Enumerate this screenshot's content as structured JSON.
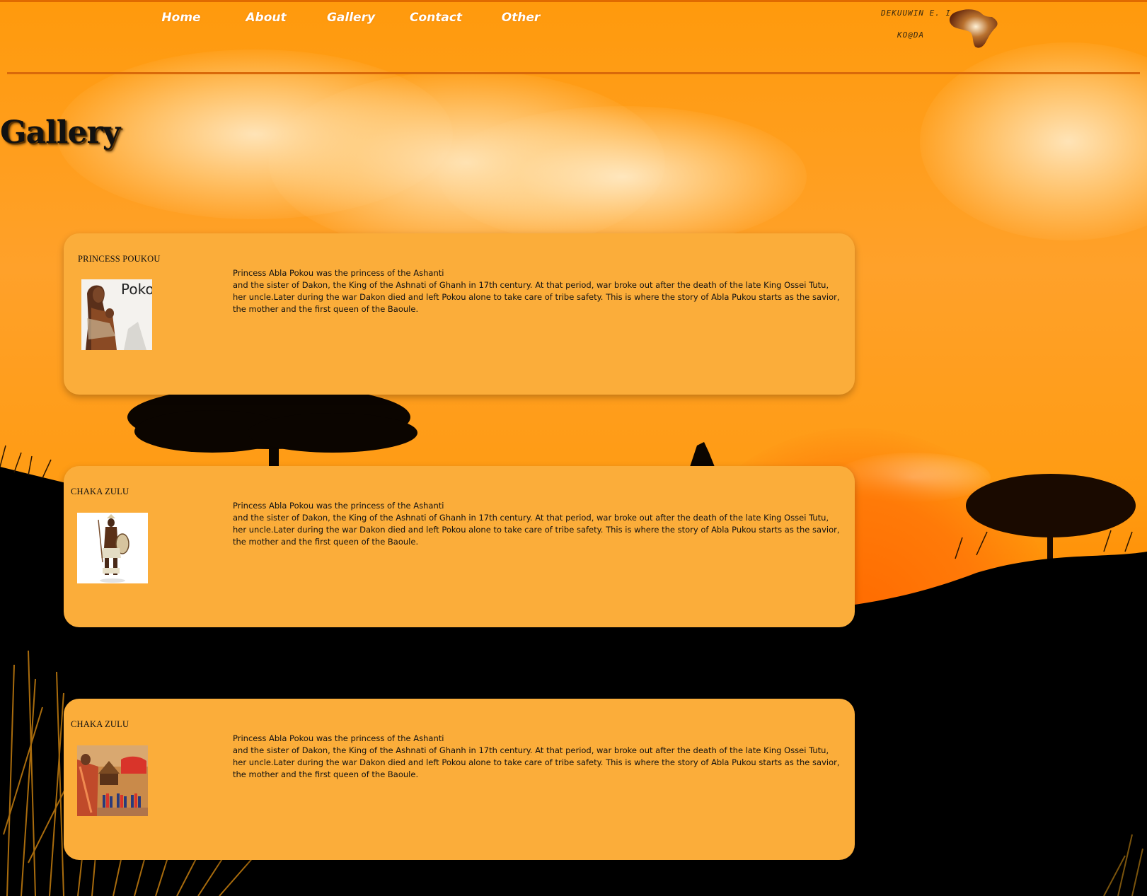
{
  "nav": {
    "items": [
      {
        "label": "Home"
      },
      {
        "label": "About"
      },
      {
        "label": "Gallery"
      },
      {
        "label": "Contact"
      },
      {
        "label": "Other"
      }
    ]
  },
  "brand": {
    "line1": "DEKUUWIN  E. I",
    "line2": "KO@DA",
    "logo_icon": "africa-map-icon"
  },
  "page": {
    "title": "Gallery"
  },
  "cards": [
    {
      "title": "PRINCESS POUKOU",
      "thumb_caption": "Pokou",
      "text_first": "Princess Abla Pokou was the princess of the Ashanti",
      "text_rest": "and the sister of Dakon, the King of the Ashnati of Ghanh in 17th century. At that period, war broke out after the death of the late King Ossei Tutu, her uncle.Later during the war Dakon died and left Pokou alone to take care of tribe safety. This is where the story of Abla Pukou starts as the savior, the mother and the first queen of the Baoule."
    },
    {
      "title": "CHAKA ZULU",
      "text_first": "Princess Abla Pokou was the princess of the Ashanti",
      "text_rest": "and the sister of Dakon, the King of the Ashnati of Ghanh in 17th century. At that period, war broke out after the death of the late King Ossei Tutu, her uncle.Later during the war Dakon died and left Pokou alone to take care of tribe safety. This is where the story of Abla Pukou starts as the savior, the mother and the first queen of the Baoule."
    },
    {
      "title": "CHAKA ZULU",
      "text_first": "Princess Abla Pokou was the princess of the Ashanti",
      "text_rest": "and the sister of Dakon, the King of the Ashnati of Ghanh in 17th century. At that period, war broke out after the death of the late King Ossei Tutu, her uncle.Later during the war Dakon died and left Pokou alone to take care of tribe safety. This is where the story of Abla Pukou starts as the savior, the mother and the first queen of the Baoule."
    }
  ],
  "colors": {
    "sky": "#ff9a10",
    "card": "#fbad3a",
    "nav_text": "#ffffff",
    "divider": "#d9690a",
    "silhouette": "#000000"
  }
}
